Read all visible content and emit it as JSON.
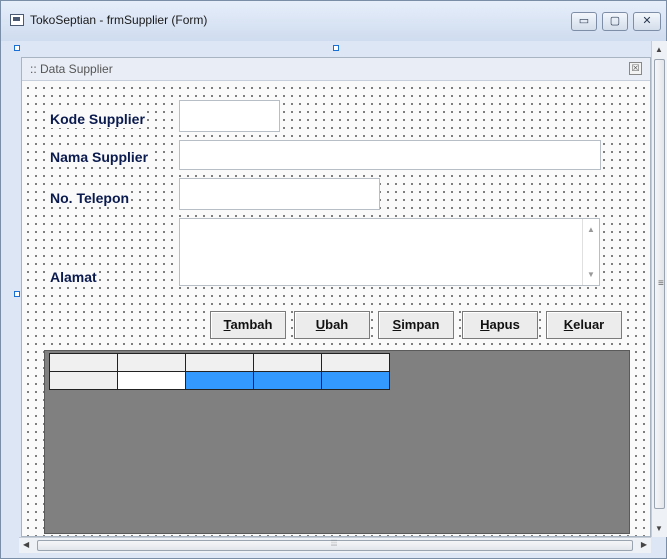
{
  "window": {
    "title": "TokoSeptian - frmSupplier (Form)",
    "controls": {
      "minimize": "▭",
      "maximize": "▢",
      "close": "✕"
    }
  },
  "form": {
    "caption": ":: Data Supplier",
    "close_glyph": "☒",
    "fields": {
      "kode_label": "Kode Supplier",
      "nama_label": "Nama Supplier",
      "telepon_label": "No. Telepon",
      "alamat_label": "Alamat"
    },
    "buttons": {
      "tambah": {
        "hotkey": "T",
        "rest": "ambah"
      },
      "ubah": {
        "hotkey": "U",
        "rest": "bah"
      },
      "simpan": {
        "hotkey": "S",
        "rest": "impan"
      },
      "hapus": {
        "hotkey": "H",
        "rest": "apus"
      },
      "keluar": {
        "hotkey": "K",
        "rest": "eluar"
      }
    }
  },
  "colors": {
    "selection": "#3399ff",
    "grid_background": "#808080",
    "label_text": "#0a1a4e"
  },
  "scrollbars": {
    "up": "▲",
    "down": "▼",
    "left": "◀",
    "right": "▶",
    "v_grip": "≡",
    "h_grip": "⦙⦙⦙"
  }
}
